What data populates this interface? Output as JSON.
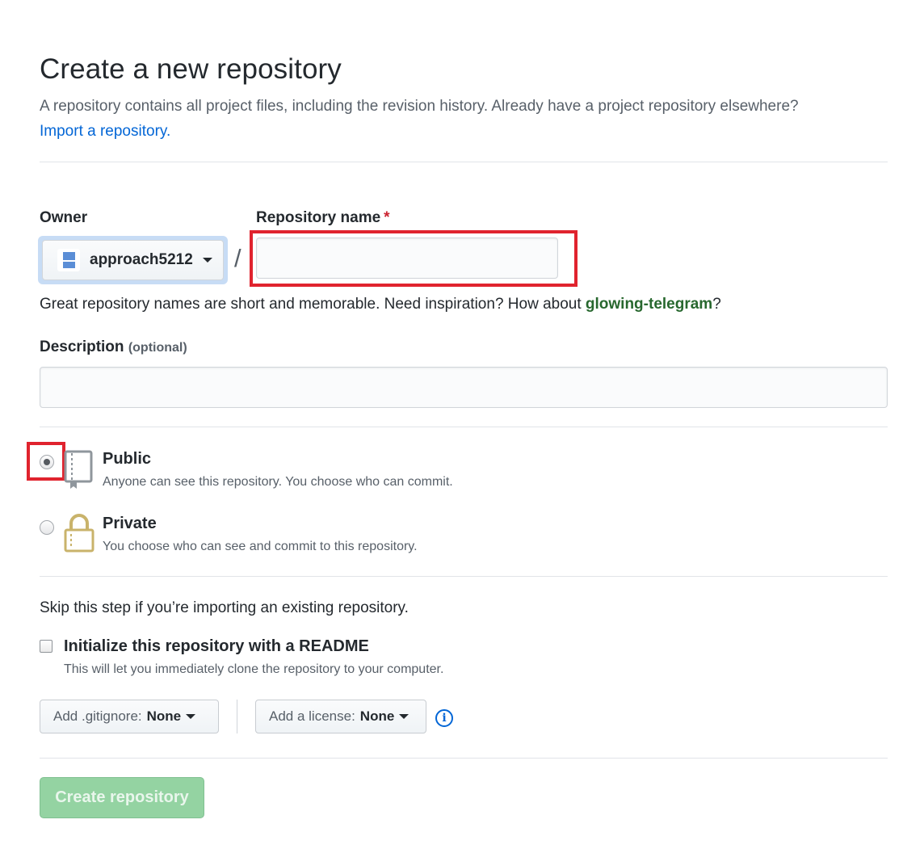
{
  "header": {
    "title": "Create a new repository",
    "subtitle": "A repository contains all project files, including the revision history. Already have a project repository elsewhere?",
    "import_link": "Import a repository."
  },
  "owner": {
    "label": "Owner",
    "value": "approach5212"
  },
  "slash": "/",
  "repo_name": {
    "label": "Repository name",
    "required_mark": "*",
    "value": "",
    "placeholder": ""
  },
  "hint": {
    "text": "Great repository names are short and memorable. Need inspiration? How about ",
    "suggestion": "glowing-telegram",
    "end": "?"
  },
  "description": {
    "label": "Description",
    "optional": "(optional)",
    "value": "",
    "placeholder": ""
  },
  "visibility": {
    "public": {
      "title": "Public",
      "desc": "Anyone can see this repository. You choose who can commit.",
      "icon": "repo-book-icon",
      "selected": true
    },
    "private": {
      "title": "Private",
      "desc": "You choose who can see and commit to this repository.",
      "icon": "lock-icon",
      "selected": false
    }
  },
  "init": {
    "skip_text": "Skip this step if you’re importing an existing repository.",
    "readme_label": "Initialize this repository with a README",
    "readme_desc": "This will let you immediately clone the repository to your computer.",
    "checked": false
  },
  "gitignore": {
    "label": "Add .gitignore:",
    "value": "None"
  },
  "license": {
    "label": "Add a license:",
    "value": "None"
  },
  "info_icon": "i",
  "submit": {
    "label": "Create repository"
  },
  "colors": {
    "link": "#0366d6",
    "highlight": "#e0232e",
    "create_button": "#94d3a2",
    "suggestion": "#28682f"
  }
}
